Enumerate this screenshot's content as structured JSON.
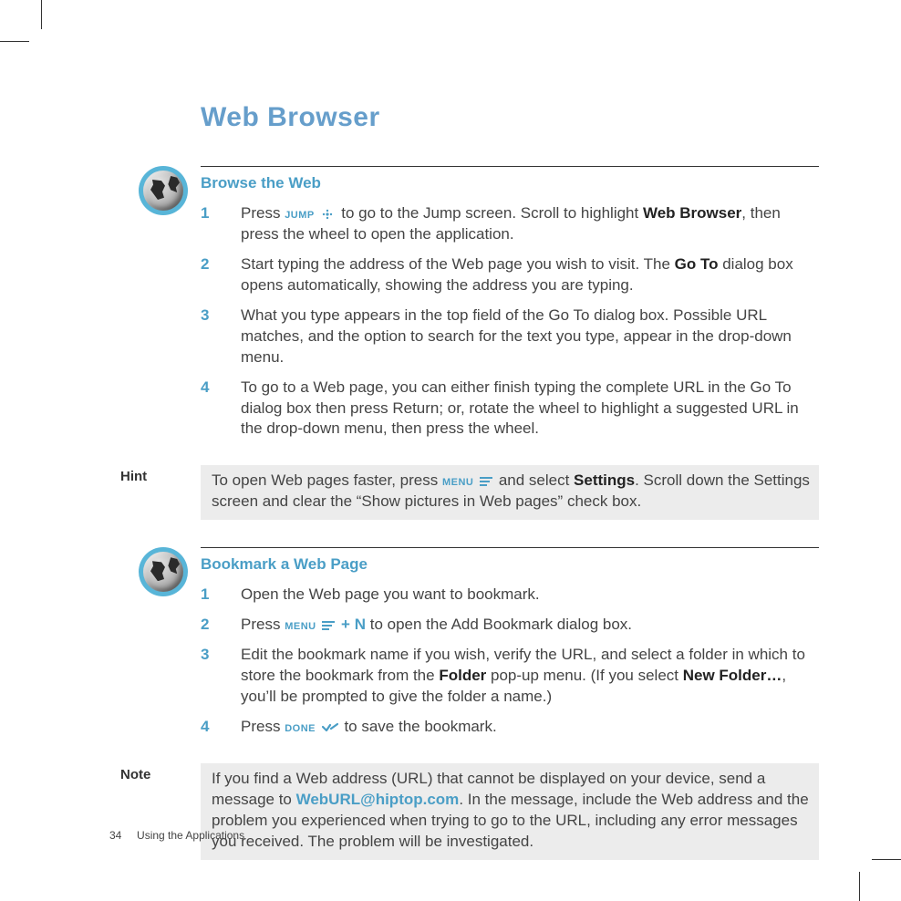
{
  "page_title": "Web Browser",
  "footer": {
    "page_number": "34",
    "section": "Using the Applications"
  },
  "browse": {
    "heading": "Browse the Web",
    "steps": {
      "s1_a": "Press ",
      "s1_jump": "JUMP",
      "s1_b": " to go to the Jump screen. Scroll to highlight ",
      "s1_bold": "Web Browser",
      "s1_c": ", then press the wheel to open the application.",
      "s2_a": "Start typing the address of the Web page you wish to visit.  The ",
      "s2_bold": "Go To",
      "s2_b": " dialog box opens automatically, showing the address you are typing.",
      "s3": "What you type appears in the top field of the Go To dialog box. Possible URL matches, and the option to search for the text you type, appear in the drop-down menu.",
      "s4": "To go to a Web page, you can either finish typing the complete URL in the Go To dialog box then press Return; or, rotate the wheel to highlight a suggested URL in the drop-down menu, then press the wheel."
    }
  },
  "hint": {
    "label": "Hint",
    "a": "To open Web pages faster, press ",
    "menu": "MENU",
    "b": " and select ",
    "bold": "Settings",
    "c": ". Scroll down the Settings screen and clear the “Show pictures in Web pages” check box."
  },
  "bookmark": {
    "heading": "Bookmark a Web Page",
    "steps": {
      "s1": "Open the Web page you want to bookmark.",
      "s2_a": "Press ",
      "s2_menu": "MENU",
      "s2_plus": " + ",
      "s2_n": "N",
      "s2_b": " to open the Add Bookmark dialog box.",
      "s3_a": "Edit the bookmark name if you wish, verify the URL, and select a folder in which to store the bookmark from the ",
      "s3_bold1": "Folder",
      "s3_b": " pop-up menu. (If you select ",
      "s3_bold2": "New Folder…",
      "s3_c": ", you’ll be prompted to give the folder a name.)",
      "s4_a": "Press ",
      "s4_done": "DONE",
      "s4_b": " to save the bookmark."
    }
  },
  "note": {
    "label": "Note",
    "a": "If you find a Web address (URL) that cannot be displayed on your device, send a message to ",
    "email": "WebURL@hiptop.com",
    "b": ". In the message, include the Web address and the problem you experienced when trying to go to the URL, including any error messages you received. The problem will be investigated."
  }
}
